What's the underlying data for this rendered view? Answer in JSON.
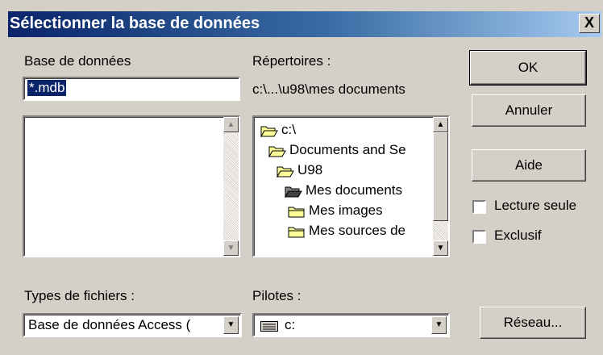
{
  "window": {
    "title": "Sélectionner la base de données",
    "close_label": "X"
  },
  "database": {
    "label": "Base de données",
    "filename_value": "*.mdb",
    "files": []
  },
  "directories": {
    "label": "Répertoires :",
    "current_path": "c:\\...\\u98\\mes documents",
    "tree": [
      {
        "label": "c:\\",
        "state": "open"
      },
      {
        "label": "Documents and Se",
        "state": "open"
      },
      {
        "label": "U98",
        "state": "open"
      },
      {
        "label": "Mes documents",
        "state": "open-current"
      },
      {
        "label": "Mes images",
        "state": "closed"
      },
      {
        "label": "Mes sources de",
        "state": "closed"
      }
    ]
  },
  "buttons": {
    "ok": "OK",
    "cancel": "Annuler",
    "help": "Aide",
    "network": "Réseau..."
  },
  "options": {
    "read_only": "Lecture seule",
    "exclusive": "Exclusif"
  },
  "file_types": {
    "label": "Types de fichiers :",
    "value": "Base de données Access ("
  },
  "drives": {
    "label": "Pilotes :",
    "value": "c:"
  },
  "icons": {
    "folder": "folder-icon",
    "drive": "drive-icon",
    "dropdown": "chevron-down-icon"
  },
  "colors": {
    "titlebar_start": "#0a246a",
    "titlebar_end": "#a6caf0",
    "selection": "#0a246a",
    "face": "#d4d0c8",
    "folder_yellow": "#ffff99"
  }
}
